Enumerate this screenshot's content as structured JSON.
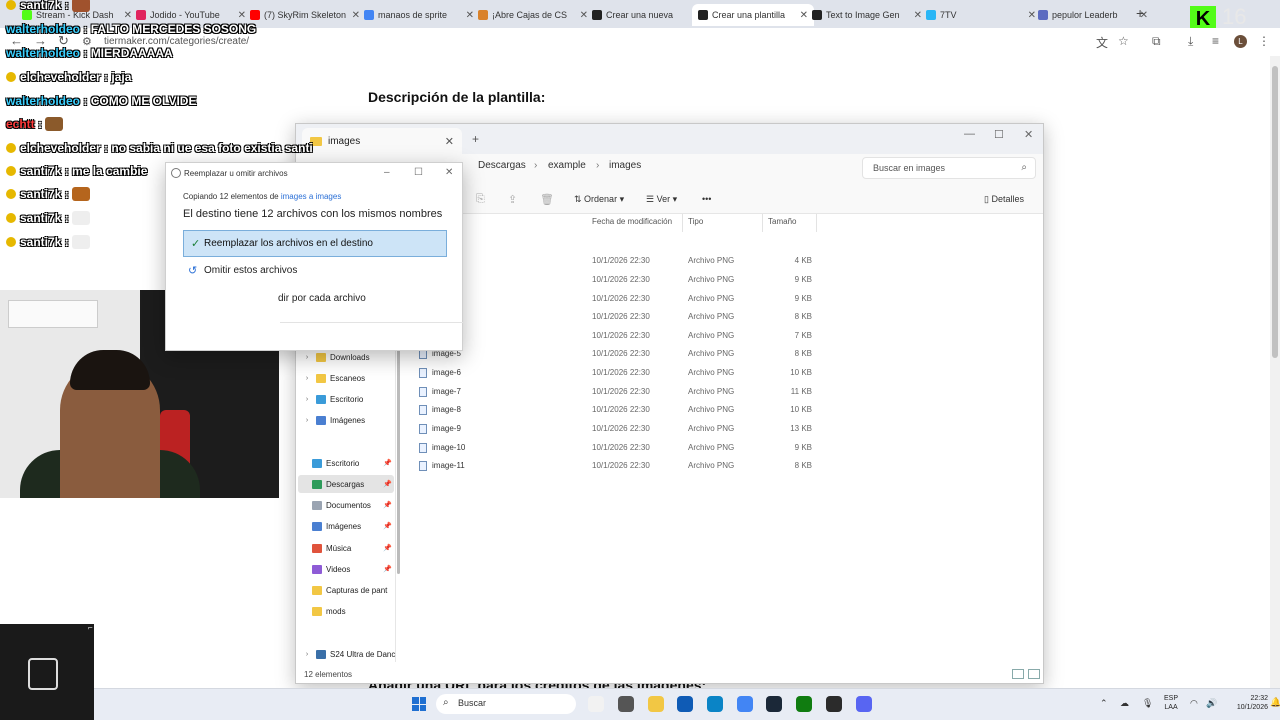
{
  "browser": {
    "tabs": [
      {
        "title": "Stream - Kick Dash",
        "color": "#53fc18"
      },
      {
        "title": "Jodido - YouTube",
        "color": "#e0245e"
      },
      {
        "title": "(7) SkyRim Skeleton",
        "color": "#ff0000"
      },
      {
        "title": "manaos de sprite",
        "color": "#4285f4"
      },
      {
        "title": "¡Abre Cajas de CS",
        "color": "#d9822b"
      },
      {
        "title": "Crear una nueva",
        "color": "#222222"
      },
      {
        "title": "Crear una plantilla",
        "color": "#222222"
      },
      {
        "title": "Text to Image Gen",
        "color": "#222222"
      },
      {
        "title": "7TV",
        "color": "#29b6f6"
      },
      {
        "title": "pepulor Leaderb",
        "color": "#5c6bc0"
      }
    ],
    "new_tab": "+",
    "url": "tiermaker.com/categories/create/",
    "profile_initial": "L",
    "kick_logo": "K",
    "kick_number": "16"
  },
  "page": {
    "heading": "Descripción de la plantilla:",
    "footer_text": "Añadir una URL para los créditos de las imágenes:"
  },
  "chat": [
    {
      "user": "santi7k",
      "badge": true,
      "message": "",
      "emote": "#a0522d",
      "color": "#ffffff"
    },
    {
      "user": "walterholdeo",
      "badge": false,
      "message": "FALTO MERCEDES SOSONG",
      "emote": "",
      "color": "#3ad0ff"
    },
    {
      "user": "walterholdeo",
      "badge": false,
      "message": "MIERDAAAAA",
      "emote": "",
      "color": "#3ad0ff"
    },
    {
      "user": "elcheveholder",
      "badge": true,
      "message": "jaja",
      "emote": "",
      "color": "#ffffff"
    },
    {
      "user": "walterholdeo",
      "badge": false,
      "message": "COMO ME OLVIDE",
      "emote": "",
      "color": "#3ad0ff"
    },
    {
      "user": "echtt",
      "badge": false,
      "message": "",
      "emote": "#8b5a2b",
      "color": "#ff3b3b"
    },
    {
      "user": "elcheveholder",
      "badge": true,
      "message": "no sabia ni ue esa foto existia santi",
      "emote": "",
      "color": "#ffffff"
    },
    {
      "user": "santi7k",
      "badge": true,
      "message": "me la cambie",
      "emote": "",
      "color": "#ffffff"
    },
    {
      "user": "santi7k",
      "badge": true,
      "message": "",
      "emote": "#b5651d",
      "color": "#ffffff"
    },
    {
      "user": "santi7k",
      "badge": true,
      "message": "",
      "emote": "#eeeeee",
      "color": "#ffffff"
    },
    {
      "user": "santi7k",
      "badge": true,
      "message": "",
      "emote": "#eeeeee",
      "color": "#ffffff"
    }
  ],
  "explorer": {
    "tab_title": "images",
    "breadcrumb": [
      "Descargas",
      "example",
      "images"
    ],
    "search_placeholder": "Buscar en images",
    "toolbar": {
      "sort": "Ordenar",
      "view": "Ver",
      "more": "•••",
      "details": "Detalles"
    },
    "columns": {
      "date": "Fecha de modificación",
      "type": "Tipo",
      "size": "Tamaño"
    },
    "files": [
      {
        "name": "",
        "date": "10/1/2026 22:30",
        "type": "Archivo PNG",
        "size": "4 KB"
      },
      {
        "name": "",
        "date": "10/1/2026 22:30",
        "type": "Archivo PNG",
        "size": "9 KB"
      },
      {
        "name": "",
        "date": "10/1/2026 22:30",
        "type": "Archivo PNG",
        "size": "9 KB"
      },
      {
        "name": "",
        "date": "10/1/2026 22:30",
        "type": "Archivo PNG",
        "size": "8 KB"
      },
      {
        "name": "",
        "date": "10/1/2026 22:30",
        "type": "Archivo PNG",
        "size": "7 KB"
      },
      {
        "name": "image-5",
        "date": "10/1/2026 22:30",
        "type": "Archivo PNG",
        "size": "8 KB"
      },
      {
        "name": "image-6",
        "date": "10/1/2026 22:30",
        "type": "Archivo PNG",
        "size": "10 KB"
      },
      {
        "name": "image-7",
        "date": "10/1/2026 22:30",
        "type": "Archivo PNG",
        "size": "11 KB"
      },
      {
        "name": "image-8",
        "date": "10/1/2026 22:30",
        "type": "Archivo PNG",
        "size": "10 KB"
      },
      {
        "name": "image-9",
        "date": "10/1/2026 22:30",
        "type": "Archivo PNG",
        "size": "13 KB"
      },
      {
        "name": "image-10",
        "date": "10/1/2026 22:30",
        "type": "Archivo PNG",
        "size": "9 KB"
      },
      {
        "name": "image-11",
        "date": "10/1/2026 22:30",
        "type": "Archivo PNG",
        "size": "8 KB"
      }
    ],
    "sidebar": [
      {
        "label": "Downloads",
        "icon": "#f2c744",
        "chevron": "›",
        "pin": "",
        "selected": false
      },
      {
        "label": "Escaneos",
        "icon": "#f2c744",
        "chevron": "›",
        "pin": "",
        "selected": false
      },
      {
        "label": "Escritorio",
        "icon": "#3a9bd9",
        "chevron": "›",
        "pin": "",
        "selected": false
      },
      {
        "label": "Imágenes",
        "icon": "#4a7fd1",
        "chevron": "›",
        "pin": "",
        "selected": false
      },
      {
        "label": "Escritorio",
        "icon": "#3a9bd9",
        "chevron": "",
        "pin": "📌",
        "selected": false
      },
      {
        "label": "Descargas",
        "icon": "#2e9b5a",
        "chevron": "",
        "pin": "📌",
        "selected": true
      },
      {
        "label": "Documentos",
        "icon": "#9aa4b2",
        "chevron": "",
        "pin": "📌",
        "selected": false
      },
      {
        "label": "Imágenes",
        "icon": "#4a7fd1",
        "chevron": "",
        "pin": "📌",
        "selected": false
      },
      {
        "label": "Música",
        "icon": "#e0533c",
        "chevron": "",
        "pin": "📌",
        "selected": false
      },
      {
        "label": "Videos",
        "icon": "#8e5bd6",
        "chevron": "",
        "pin": "📌",
        "selected": false
      },
      {
        "label": "Capturas de pant",
        "icon": "#f2c744",
        "chevron": "",
        "pin": "",
        "selected": false
      },
      {
        "label": "mods",
        "icon": "#f2c744",
        "chevron": "",
        "pin": "",
        "selected": false
      },
      {
        "label": "S24 Ultra de Danc",
        "icon": "#3a6fa8",
        "chevron": "›",
        "pin": "",
        "selected": false
      }
    ],
    "status": "12 elementos"
  },
  "dialog": {
    "title": "Reemplazar u omitir archivos",
    "copy_prefix": "Copiando 12 elementos de ",
    "copy_link": "images a images",
    "message": "El destino tiene 12 archivos con los mismos nombres",
    "option_replace": "Reemplazar los archivos en el destino",
    "option_skip": "Omitir estos archivos",
    "option_decide": "dir por cada archivo"
  },
  "taskbar": {
    "search": "Buscar",
    "lang": "ESP",
    "lang2": "LAA",
    "time": "22:32",
    "date": "10/1/2026",
    "apps": [
      "#f2f2f2",
      "#555555",
      "#f2c744",
      "#0f5bb5",
      "#0a84c6",
      "#4285f4",
      "#1b2838",
      "#107c10",
      "#2b2b2b",
      "#5865f2"
    ]
  }
}
